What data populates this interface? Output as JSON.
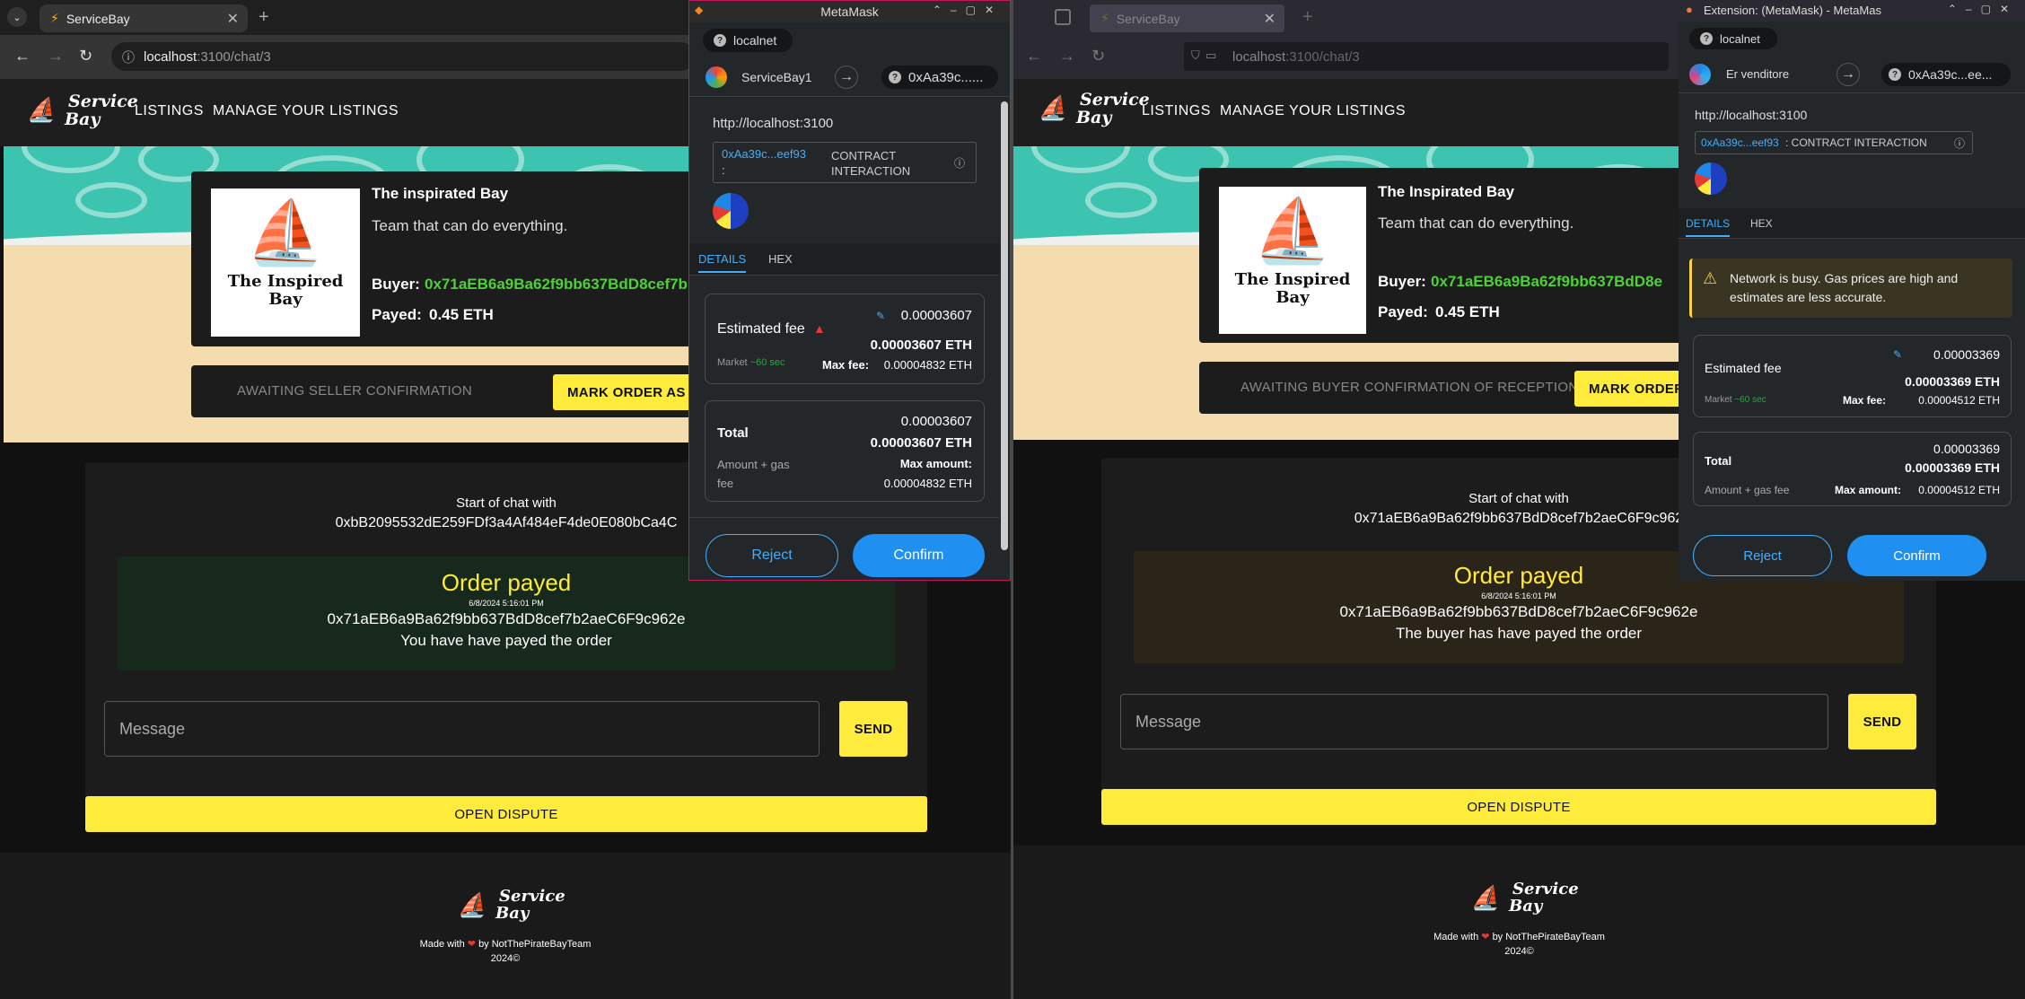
{
  "left": {
    "tab_title": "ServiceBay",
    "url_host": "localhost",
    "url_path": ":3100/chat/3",
    "nav": {
      "logo_line1": "Service",
      "logo_line2": "Bay",
      "listings": "LISTINGS",
      "manage": "MANAGE YOUR LISTINGS"
    },
    "listing": {
      "image_text_line1": "The Inspired",
      "image_text_line2": "Bay",
      "name": "The inspirated Bay",
      "description": "Team that can do everything.",
      "buyer_label": "Buyer:",
      "buyer_value": "0x71aEB6a9Ba62f9bb637BdD8cef7b",
      "payed_label": "Payed:",
      "payed_value": "0.45 ETH"
    },
    "status": {
      "text": "AWAITING SELLER CONFIRMATION",
      "button": "MARK ORDER AS P"
    },
    "chat": {
      "start": "Start of chat with",
      "address": "0xbB2095532dE259FDf3a4Af484eF4de0E080bCa4C",
      "order_title": "Order payed",
      "order_time": "6/8/2024 5:16:01 PM",
      "order_address": "0x71aEB6a9Ba62f9bb637BdD8cef7b2aeC6F9c962e",
      "order_note": "You have have payed the order",
      "message_placeholder": "Message",
      "send": "SEND",
      "dispute": "OPEN DISPUTE"
    },
    "footer": {
      "made": "Made with",
      "by": "by NotThePirateBayTeam",
      "year": "2024©"
    }
  },
  "left_mm": {
    "title": "MetaMask",
    "network": "localnet",
    "account": "ServiceBay1",
    "to_account": "0xAa39c......",
    "origin": "http://localhost:3100",
    "contract": "0xAa39c...eef93",
    "contract_sep": ":",
    "interaction": "CONTRACT INTERACTION",
    "tabs": [
      "DETAILS",
      "HEX"
    ],
    "est_fee_label": "Estimated fee",
    "est_fee_top": "0.00003607",
    "est_fee_eth": "0.00003607 ETH",
    "market": "Market",
    "market_time": "~60 sec",
    "max_fee_label": "Max fee:",
    "max_fee": "0.00004832 ETH",
    "total_label": "Total",
    "total_top": "0.00003607",
    "total_eth": "0.00003607 ETH",
    "amount_gas": "Amount + gas fee",
    "max_amount_label": "Max amount:",
    "max_amount": "0.00004832 ETH",
    "reject": "Reject",
    "confirm": "Confirm"
  },
  "right": {
    "tab_title": "ServiceBay",
    "url_host": "localhost",
    "url_path": ":3100/chat/3",
    "nav": {
      "logo_line1": "Service",
      "logo_line2": "Bay",
      "listings": "LISTINGS",
      "manage": "MANAGE YOUR LISTINGS"
    },
    "listing": {
      "image_text_line1": "The Inspired",
      "image_text_line2": "Bay",
      "name": "The Inspirated Bay",
      "description": "Team that can do everything.",
      "buyer_label": "Buyer:",
      "buyer_value": "0x71aEB6a9Ba62f9bb637BdD8e",
      "payed_label": "Payed:",
      "payed_value": "0.45 ETH"
    },
    "status": {
      "text": "AWAITING BUYER CONFIRMATION OF RECEPTION",
      "button": "MARK ORDER"
    },
    "chat": {
      "start": "Start of chat with",
      "address": "0x71aEB6a9Ba62f9bb637BdD8cef7b2aeC6F9c962",
      "order_title": "Order payed",
      "order_time": "6/8/2024 5:16:01 PM",
      "order_address": "0x71aEB6a9Ba62f9bb637BdD8cef7b2aeC6F9c962e",
      "order_note": "The buyer has have payed the order",
      "message_placeholder": "Message",
      "send": "SEND",
      "dispute": "OPEN DISPUTE"
    },
    "footer": {
      "made": "Made with",
      "by": "by NotThePirateBayTeam",
      "year": "2024©"
    }
  },
  "right_mm": {
    "title": "Extension: (MetaMask) - MetaMas",
    "network": "localnet",
    "account": "Er venditore",
    "to_account": "0xAa39c...ee...",
    "origin": "http://localhost:3100",
    "contract": "0xAa39c...eef93",
    "interaction": ": CONTRACT INTERACTION",
    "tabs": [
      "DETAILS",
      "HEX"
    ],
    "warning": "Network is busy. Gas prices are high and estimates are less accurate.",
    "est_fee_label": "Estimated fee",
    "est_fee_top": "0.00003369",
    "est_fee_eth": "0.00003369 ETH",
    "market": "Market",
    "market_time": "~60 sec",
    "max_fee_label": "Max fee:",
    "max_fee": "0.00004512 ETH",
    "total_label": "Total",
    "total_top": "0.00003369",
    "total_eth": "0.00003369 ETH",
    "amount_gas": "Amount + gas fee",
    "max_amount_label": "Max amount:",
    "max_amount": "0.00004512 ETH",
    "reject": "Reject",
    "confirm": "Confirm"
  },
  "colors": {
    "accent_yellow": "#ffeb3b",
    "address_green": "#4cd137",
    "mm_blue": "#1f8ff2",
    "order_green_bg": "#17291c",
    "order_brown_bg": "#2b2418"
  }
}
